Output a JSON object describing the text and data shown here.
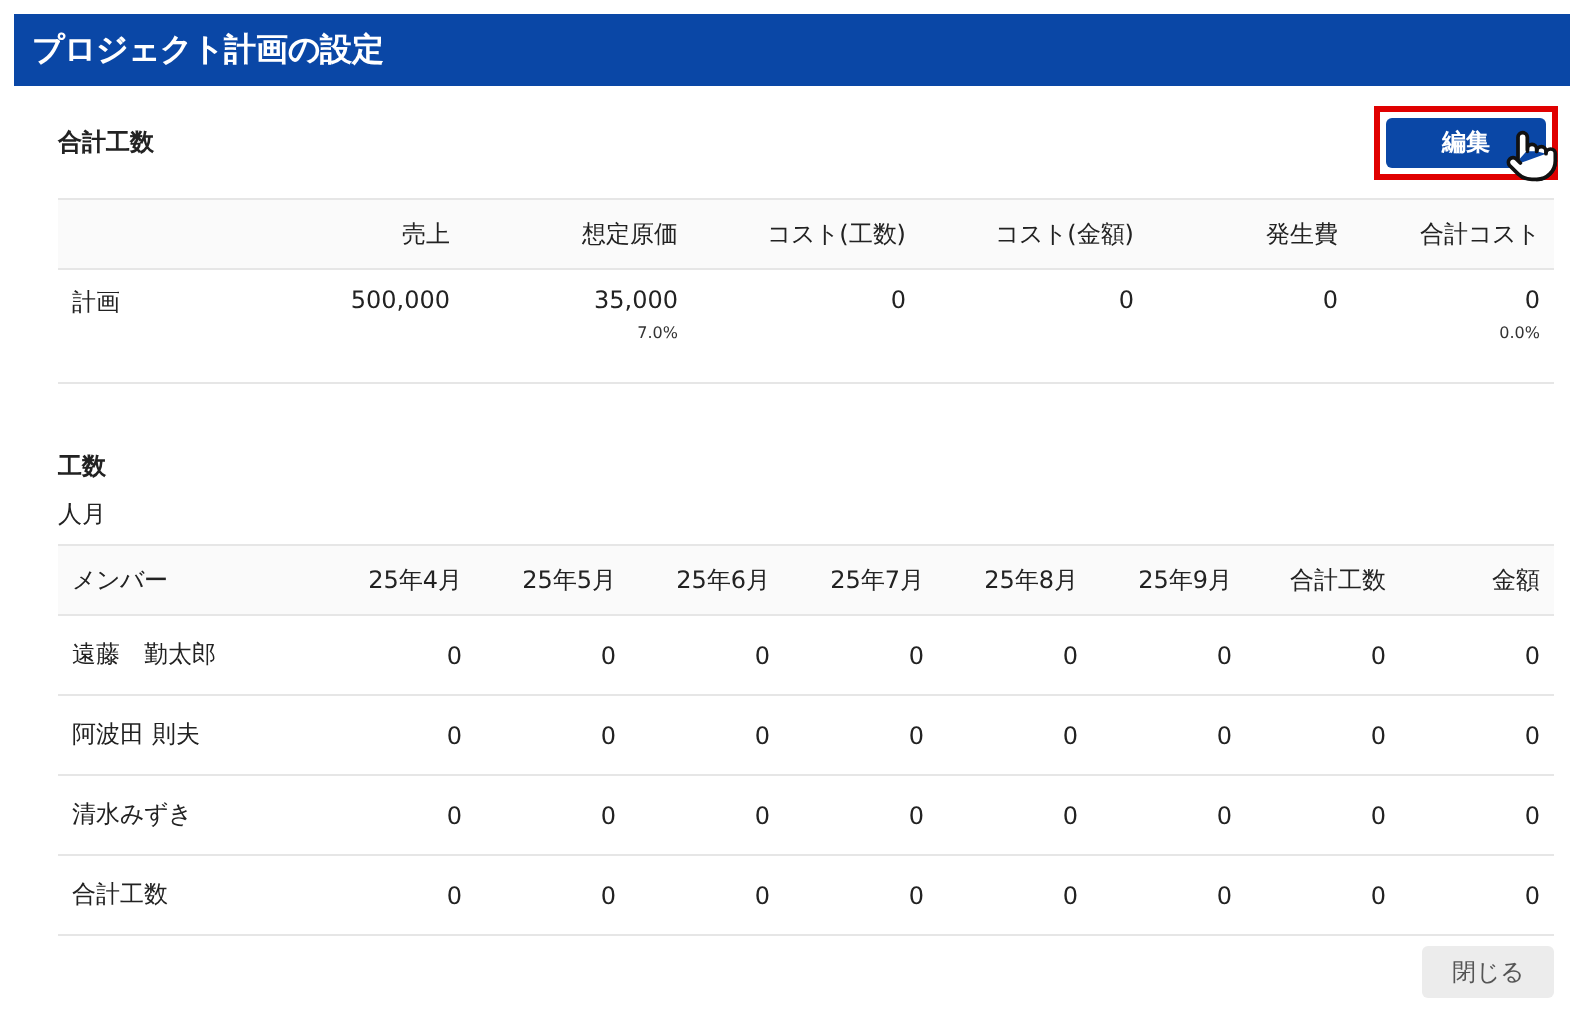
{
  "window": {
    "title": "プロジェクト計画の設定"
  },
  "summary": {
    "heading": "合計工数",
    "edit_button": {
      "label": "編集",
      "highlighted": true
    },
    "columns": [
      "",
      "売上",
      "想定原価",
      "コスト(工数)",
      "コスト(金額)",
      "発生費",
      "合計コスト"
    ],
    "rows": [
      {
        "cells": [
          {
            "value": "計画"
          },
          {
            "value": "500,000"
          },
          {
            "value": "35,000",
            "sub": "7.0%"
          },
          {
            "value": "0"
          },
          {
            "value": "0"
          },
          {
            "value": "0"
          },
          {
            "value": "0",
            "sub": "0.0%"
          }
        ]
      }
    ]
  },
  "effort": {
    "heading": "工数",
    "unit": "人月",
    "columns": [
      "メンバー",
      "25年4月",
      "25年5月",
      "25年6月",
      "25年7月",
      "25年8月",
      "25年9月",
      "合計工数",
      "金額"
    ],
    "rows": [
      {
        "cells": [
          "遠藤　勤太郎",
          "0",
          "0",
          "0",
          "0",
          "0",
          "0",
          "0",
          "0"
        ]
      },
      {
        "cells": [
          "阿波田 則夫",
          "0",
          "0",
          "0",
          "0",
          "0",
          "0",
          "0",
          "0"
        ]
      },
      {
        "cells": [
          "清水みずき",
          "0",
          "0",
          "0",
          "0",
          "0",
          "0",
          "0",
          "0"
        ]
      },
      {
        "cells": [
          "合計工数",
          "0",
          "0",
          "0",
          "0",
          "0",
          "0",
          "0",
          "0"
        ]
      }
    ]
  },
  "footer": {
    "close_button": "閉じる"
  }
}
